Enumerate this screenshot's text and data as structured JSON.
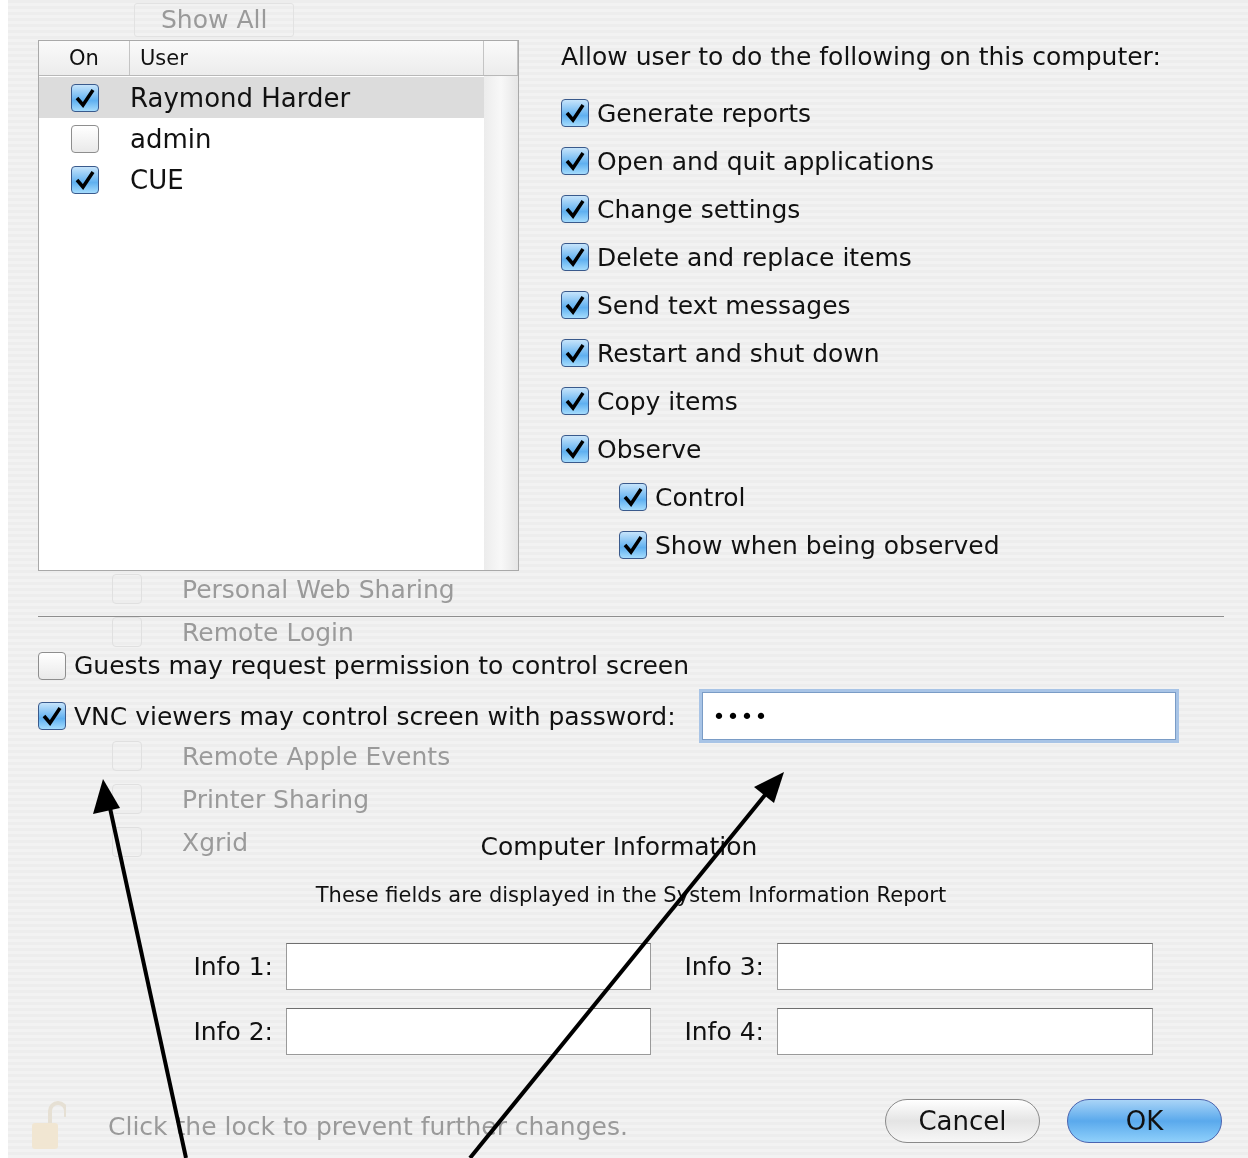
{
  "background_window": {
    "toolbar_button": "Show All",
    "services_top": [
      {
        "label": "Personal Web Sharing",
        "checked": false
      },
      {
        "label": "Remote Login",
        "checked": false
      }
    ],
    "services_bottom": [
      {
        "label": "Remote Apple Events",
        "checked": false
      },
      {
        "label": "Printer Sharing",
        "checked": false
      },
      {
        "label": "Xgrid",
        "checked": false
      }
    ],
    "lock_text": "Click the lock to prevent further changes."
  },
  "sheet": {
    "user_table": {
      "columns": [
        "On",
        "User"
      ],
      "rows": [
        {
          "on": true,
          "user": "Raymond Harder",
          "selected": true
        },
        {
          "on": false,
          "user": "admin",
          "selected": false
        },
        {
          "on": true,
          "user": "CUE",
          "selected": false
        }
      ]
    },
    "permissions": {
      "title": "Allow user to do the following on this computer:",
      "items": [
        {
          "label": "Generate reports",
          "checked": true
        },
        {
          "label": "Open and quit applications",
          "checked": true
        },
        {
          "label": "Change settings",
          "checked": true
        },
        {
          "label": "Delete and replace items",
          "checked": true
        },
        {
          "label": "Send text messages",
          "checked": true
        },
        {
          "label": "Restart and shut down",
          "checked": true
        },
        {
          "label": "Copy items",
          "checked": true
        },
        {
          "label": "Observe",
          "checked": true,
          "children": [
            {
              "label": "Control",
              "checked": true
            },
            {
              "label": "Show when being observed",
              "checked": true
            }
          ]
        }
      ]
    },
    "guests": {
      "label": "Guests may request permission to control screen",
      "checked": false
    },
    "vnc": {
      "label": "VNC viewers may control screen with password:",
      "checked": true,
      "value": "••••"
    },
    "computer_info": {
      "title": "Computer Information",
      "subtitle": "These fields are displayed in the System Information Report",
      "fields": [
        {
          "label": "Info 1:"
        },
        {
          "label": "Info 3:"
        },
        {
          "label": "Info 2:"
        },
        {
          "label": "Info 4:"
        }
      ]
    },
    "buttons": [
      {
        "label": "Cancel",
        "default": false
      },
      {
        "label": "OK",
        "default": true
      }
    ]
  }
}
